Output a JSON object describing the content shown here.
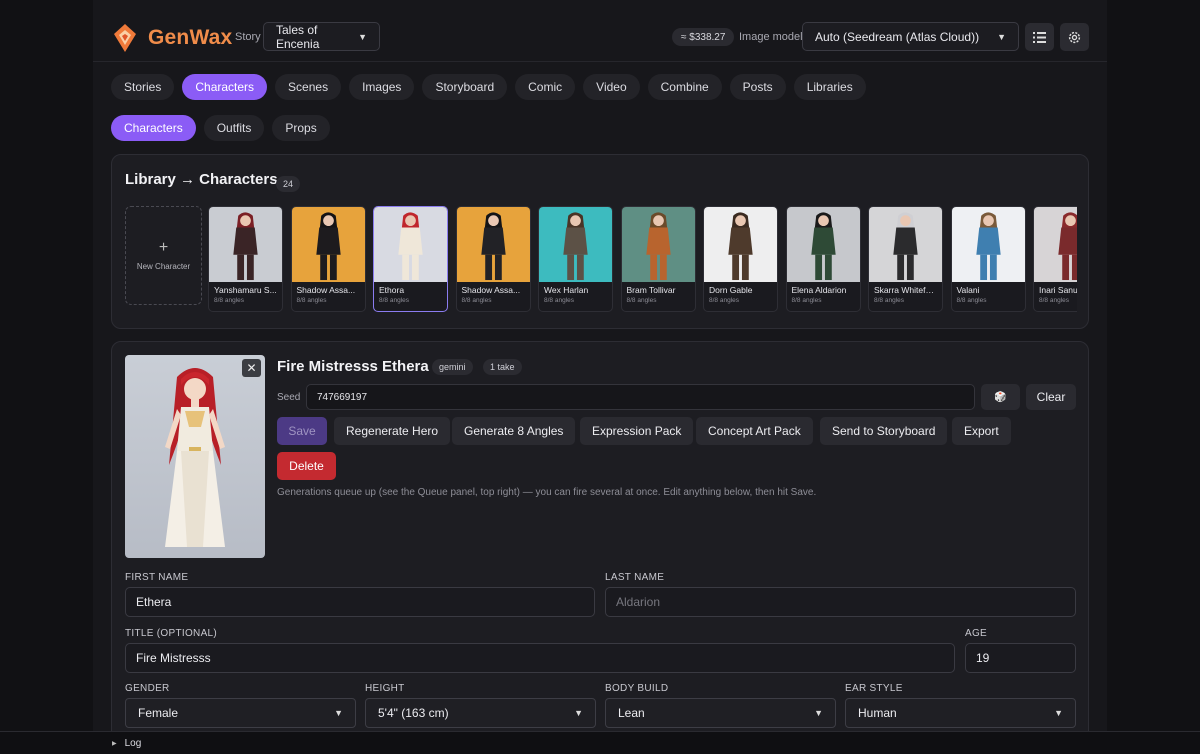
{
  "app": {
    "brand": "GenWax"
  },
  "header": {
    "story_label": "Story",
    "story_value": "Tales of Encenia",
    "cost": "≈ $338.27",
    "image_model_label": "Image model",
    "image_model_value": "Auto (Seedream (Atlas Cloud))"
  },
  "main_tabs": [
    "Stories",
    "Characters",
    "Scenes",
    "Images",
    "Storyboard",
    "Comic",
    "Video",
    "Combine",
    "Posts",
    "Libraries"
  ],
  "main_tab_active": "Characters",
  "sub_tabs": [
    "Characters",
    "Outfits",
    "Props"
  ],
  "sub_tab_active": "Characters",
  "library": {
    "title": "Library → Characters",
    "count": "24",
    "new_label": "New Character",
    "characters": [
      {
        "name": "Yanshamaru S...",
        "angles": "8/8 angles",
        "bg": "#c9ccd2",
        "outfit": "#3a2426",
        "hair": "#7a1f25"
      },
      {
        "name": "Shadow Assa...",
        "angles": "8/8 angles",
        "bg": "#e7a33c",
        "outfit": "#1d1b1e",
        "hair": "#151315"
      },
      {
        "name": "Ethora",
        "angles": "8/8 angles",
        "bg": "#d8dae2",
        "outfit": "#efe7d9",
        "hair": "#c0262c"
      },
      {
        "name": "Shadow Assa...",
        "angles": "8/8 angles",
        "bg": "#e7a33c",
        "outfit": "#222226",
        "hair": "#141416"
      },
      {
        "name": "Wex Harlan",
        "angles": "8/8 angles",
        "bg": "#3dbbbf",
        "outfit": "#5c5146",
        "hair": "#4a3426"
      },
      {
        "name": "Bram Tollivar",
        "angles": "8/8 angles",
        "bg": "#5f8f84",
        "outfit": "#b8642e",
        "hair": "#6b4a2a"
      },
      {
        "name": "Dorn Gable",
        "angles": "8/8 angles",
        "bg": "#eeeeef",
        "outfit": "#4e3a2c",
        "hair": "#3a2a20"
      },
      {
        "name": "Elena Aldarion",
        "angles": "8/8 angles",
        "bg": "#c6c8cc",
        "outfit": "#2e4a36",
        "hair": "#1a1a1a"
      },
      {
        "name": "Skarra Whitefa...",
        "angles": "8/8 angles",
        "bg": "#d5d5d7",
        "outfit": "#2b2b2d",
        "hair": "#cfcfd3"
      },
      {
        "name": "Valani",
        "angles": "8/8 angles",
        "bg": "#eef0f3",
        "outfit": "#3f7fb0",
        "hair": "#7a5a3a"
      },
      {
        "name": "Inari Sanu...",
        "angles": "8/8 angles",
        "bg": "#d7d4d6",
        "outfit": "#7a2a2c",
        "hair": "#8a2a2c"
      }
    ]
  },
  "editor": {
    "name": "Fire Mistresss Ethera",
    "provider_badge": "gemini",
    "takes_badge": "1 take",
    "seed_label": "Seed",
    "seed_value": "747669197",
    "dice_label": "🎲",
    "clear_label": "Clear",
    "buttons": {
      "save": "Save",
      "regenerate": "Regenerate Hero",
      "angles": "Generate 8 Angles",
      "expression": "Expression Pack",
      "concept": "Concept Art Pack",
      "storyboard": "Send to Storyboard",
      "export": "Export",
      "delete": "Delete"
    },
    "hint": "Generations queue up (see the Queue panel, top right) — you can fire several at once. Edit anything below, then hit Save."
  },
  "form": {
    "first_name_label": "FIRST NAME",
    "first_name_value": "Ethera",
    "last_name_label": "LAST NAME",
    "last_name_placeholder": "Aldarion",
    "title_label": "TITLE (OPTIONAL)",
    "title_value": "Fire Mistresss",
    "age_label": "AGE",
    "age_value": "19",
    "gender_label": "GENDER",
    "gender_value": "Female",
    "height_label": "HEIGHT",
    "height_value": "5'4\" (163 cm)",
    "build_label": "BODY BUILD",
    "build_value": "Lean",
    "ear_label": "EAR STYLE",
    "ear_value": "Human"
  },
  "log": {
    "label": "Log"
  },
  "icons": {
    "logo": "genwax-logo-icon",
    "list": "list-icon",
    "settings": "gear-icon",
    "close": "close-icon",
    "dice": "dice-icon",
    "plus": "plus-icon"
  },
  "colors": {
    "accent": "#8b5cf6",
    "brand": "#f08c4a",
    "danger": "#c42a30"
  }
}
